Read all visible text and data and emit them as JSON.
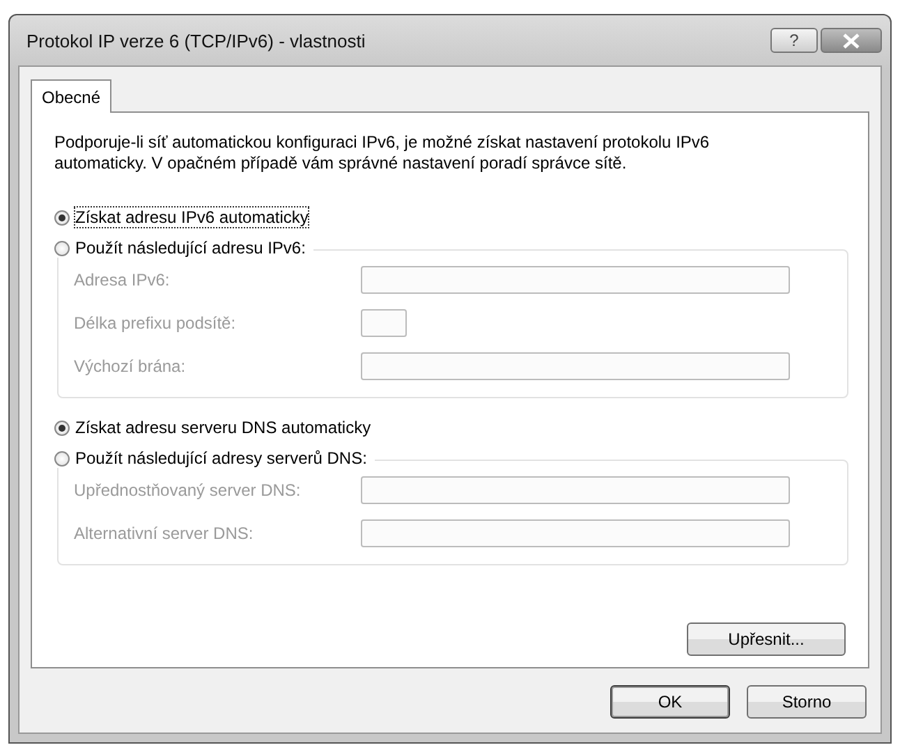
{
  "window": {
    "title": "Protokol IP verze 6 (TCP/IPv6) - vlastnosti",
    "help_button": "?"
  },
  "tabs": [
    {
      "label": "Obecné",
      "selected": true
    }
  ],
  "description": "Podporuje-li síť automatickou konfiguraci IPv6, je možné získat nastavení protokolu IPv6 automaticky. V opačném případě vám správné nastavení poradí správce sítě.",
  "sections": [
    {
      "auto_option": {
        "label": "Získat adresu IPv6 automaticky",
        "selected": true,
        "focused": true
      },
      "manual_option": {
        "label": "Použít následující adresu IPv6:",
        "selected": false,
        "focused": false
      },
      "fields": [
        {
          "label": "Adresa IPv6:",
          "kind": "wide",
          "disabled": true
        },
        {
          "label": "Délka prefixu podsítě:",
          "kind": "short",
          "disabled": true
        },
        {
          "label": "Výchozí brána:",
          "kind": "wide",
          "disabled": true
        }
      ]
    },
    {
      "auto_option": {
        "label": "Získat adresu serveru DNS automaticky",
        "selected": true,
        "focused": false
      },
      "manual_option": {
        "label": "Použít následující adresy serverů DNS:",
        "selected": false,
        "focused": false
      },
      "fields": [
        {
          "label": "Upřednostňovaný server DNS:",
          "kind": "wide",
          "disabled": true
        },
        {
          "label": "Alternativní server DNS:",
          "kind": "wide",
          "disabled": true
        }
      ]
    }
  ],
  "advanced_button": "Upřesnit...",
  "buttons": [
    {
      "label": "OK",
      "default": true
    },
    {
      "label": "Storno",
      "default": false
    }
  ]
}
